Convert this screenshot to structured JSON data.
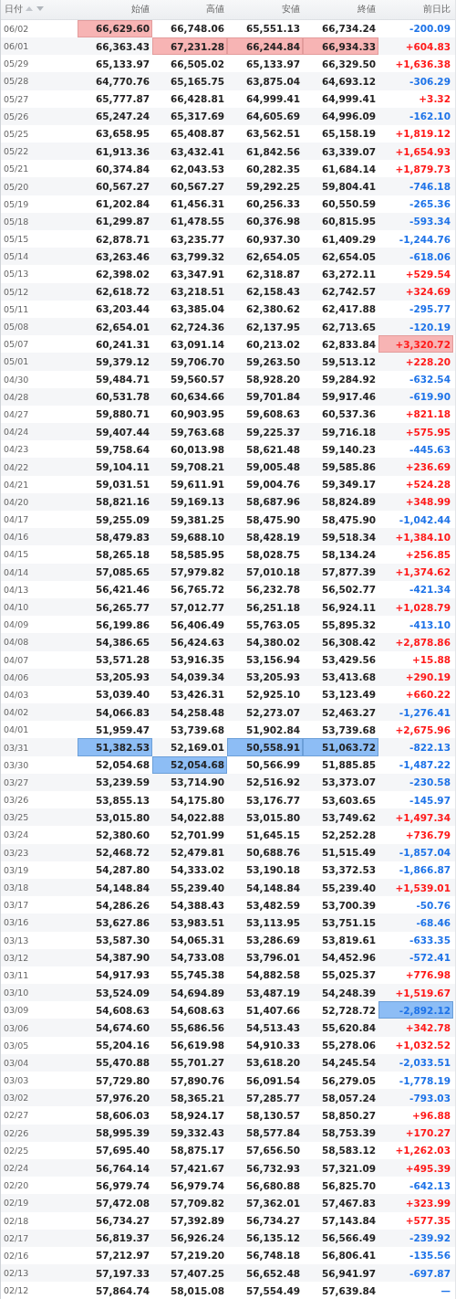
{
  "table": {
    "columns": [
      {
        "label": "日付",
        "sortable": true
      },
      {
        "label": "始値",
        "sortable": false
      },
      {
        "label": "高値",
        "sortable": false
      },
      {
        "label": "安値",
        "sortable": false
      },
      {
        "label": "終値",
        "sortable": false
      },
      {
        "label": "前日比",
        "sortable": false
      }
    ],
    "rows": [
      {
        "date": "06/02",
        "open": "66,629.60",
        "high": "66,748.06",
        "low": "65,551.13",
        "close": "66,734.24",
        "change": "-200.09",
        "up": false,
        "highest": {
          "open": true
        }
      },
      {
        "date": "06/01",
        "open": "66,363.43",
        "high": "67,231.28",
        "low": "66,244.84",
        "close": "66,934.33",
        "change": "+604.83",
        "up": true,
        "highest": {
          "high": true,
          "low": true,
          "close": true
        }
      },
      {
        "date": "05/29",
        "open": "65,133.97",
        "high": "66,505.02",
        "low": "65,133.97",
        "close": "66,329.50",
        "change": "+1,636.38",
        "up": true
      },
      {
        "date": "05/28",
        "open": "64,770.76",
        "high": "65,165.75",
        "low": "63,875.04",
        "close": "64,693.12",
        "change": "-306.29",
        "up": false
      },
      {
        "date": "05/27",
        "open": "65,777.87",
        "high": "66,428.81",
        "low": "64,999.41",
        "close": "64,999.41",
        "change": "+3.32",
        "up": true
      },
      {
        "date": "05/26",
        "open": "65,247.24",
        "high": "65,317.69",
        "low": "64,605.69",
        "close": "64,996.09",
        "change": "-162.10",
        "up": false
      },
      {
        "date": "05/25",
        "open": "63,658.95",
        "high": "65,408.87",
        "low": "63,562.51",
        "close": "65,158.19",
        "change": "+1,819.12",
        "up": true
      },
      {
        "date": "05/22",
        "open": "61,913.36",
        "high": "63,432.41",
        "low": "61,842.56",
        "close": "63,339.07",
        "change": "+1,654.93",
        "up": true
      },
      {
        "date": "05/21",
        "open": "60,374.84",
        "high": "62,043.53",
        "low": "60,282.35",
        "close": "61,684.14",
        "change": "+1,879.73",
        "up": true
      },
      {
        "date": "05/20",
        "open": "60,567.27",
        "high": "60,567.27",
        "low": "59,292.25",
        "close": "59,804.41",
        "change": "-746.18",
        "up": false
      },
      {
        "date": "05/19",
        "open": "61,202.84",
        "high": "61,456.31",
        "low": "60,256.33",
        "close": "60,550.59",
        "change": "-265.36",
        "up": false
      },
      {
        "date": "05/18",
        "open": "61,299.87",
        "high": "61,478.55",
        "low": "60,376.98",
        "close": "60,815.95",
        "change": "-593.34",
        "up": false
      },
      {
        "date": "05/15",
        "open": "62,878.71",
        "high": "63,235.77",
        "low": "60,937.30",
        "close": "61,409.29",
        "change": "-1,244.76",
        "up": false
      },
      {
        "date": "05/14",
        "open": "63,263.46",
        "high": "63,799.32",
        "low": "62,654.05",
        "close": "62,654.05",
        "change": "-618.06",
        "up": false
      },
      {
        "date": "05/13",
        "open": "62,398.02",
        "high": "63,347.91",
        "low": "62,318.87",
        "close": "63,272.11",
        "change": "+529.54",
        "up": true
      },
      {
        "date": "05/12",
        "open": "62,618.72",
        "high": "63,218.51",
        "low": "62,158.43",
        "close": "62,742.57",
        "change": "+324.69",
        "up": true
      },
      {
        "date": "05/11",
        "open": "63,203.44",
        "high": "63,385.04",
        "low": "62,380.62",
        "close": "62,417.88",
        "change": "-295.77",
        "up": false
      },
      {
        "date": "05/08",
        "open": "62,654.01",
        "high": "62,724.36",
        "low": "62,137.95",
        "close": "62,713.65",
        "change": "-120.19",
        "up": false
      },
      {
        "date": "05/07",
        "open": "60,241.31",
        "high": "63,091.14",
        "low": "60,213.02",
        "close": "62,833.84",
        "change": "+3,320.72",
        "up": true,
        "highest": {
          "change": true
        }
      },
      {
        "date": "05/01",
        "open": "59,379.12",
        "high": "59,706.70",
        "low": "59,263.50",
        "close": "59,513.12",
        "change": "+228.20",
        "up": true
      },
      {
        "date": "04/30",
        "open": "59,484.71",
        "high": "59,560.57",
        "low": "58,928.20",
        "close": "59,284.92",
        "change": "-632.54",
        "up": false
      },
      {
        "date": "04/28",
        "open": "60,531.78",
        "high": "60,634.66",
        "low": "59,701.84",
        "close": "59,917.46",
        "change": "-619.90",
        "up": false
      },
      {
        "date": "04/27",
        "open": "59,880.71",
        "high": "60,903.95",
        "low": "59,608.63",
        "close": "60,537.36",
        "change": "+821.18",
        "up": true
      },
      {
        "date": "04/24",
        "open": "59,407.44",
        "high": "59,763.68",
        "low": "59,225.37",
        "close": "59,716.18",
        "change": "+575.95",
        "up": true
      },
      {
        "date": "04/23",
        "open": "59,758.64",
        "high": "60,013.98",
        "low": "58,621.48",
        "close": "59,140.23",
        "change": "-445.63",
        "up": false
      },
      {
        "date": "04/22",
        "open": "59,104.11",
        "high": "59,708.21",
        "low": "59,005.48",
        "close": "59,585.86",
        "change": "+236.69",
        "up": true
      },
      {
        "date": "04/21",
        "open": "59,031.51",
        "high": "59,611.91",
        "low": "59,004.76",
        "close": "59,349.17",
        "change": "+524.28",
        "up": true
      },
      {
        "date": "04/20",
        "open": "58,821.16",
        "high": "59,169.13",
        "low": "58,687.96",
        "close": "58,824.89",
        "change": "+348.99",
        "up": true
      },
      {
        "date": "04/17",
        "open": "59,255.09",
        "high": "59,381.25",
        "low": "58,475.90",
        "close": "58,475.90",
        "change": "-1,042.44",
        "up": false
      },
      {
        "date": "04/16",
        "open": "58,479.83",
        "high": "59,688.10",
        "low": "58,428.19",
        "close": "59,518.34",
        "change": "+1,384.10",
        "up": true
      },
      {
        "date": "04/15",
        "open": "58,265.18",
        "high": "58,585.95",
        "low": "58,028.75",
        "close": "58,134.24",
        "change": "+256.85",
        "up": true
      },
      {
        "date": "04/14",
        "open": "57,085.65",
        "high": "57,979.82",
        "low": "57,010.18",
        "close": "57,877.39",
        "change": "+1,374.62",
        "up": true
      },
      {
        "date": "04/13",
        "open": "56,421.46",
        "high": "56,765.72",
        "low": "56,232.78",
        "close": "56,502.77",
        "change": "-421.34",
        "up": false
      },
      {
        "date": "04/10",
        "open": "56,265.77",
        "high": "57,012.77",
        "low": "56,251.18",
        "close": "56,924.11",
        "change": "+1,028.79",
        "up": true
      },
      {
        "date": "04/09",
        "open": "56,199.86",
        "high": "56,406.49",
        "low": "55,763.05",
        "close": "55,895.32",
        "change": "-413.10",
        "up": false
      },
      {
        "date": "04/08",
        "open": "54,386.65",
        "high": "56,424.63",
        "low": "54,380.02",
        "close": "56,308.42",
        "change": "+2,878.86",
        "up": true
      },
      {
        "date": "04/07",
        "open": "53,571.28",
        "high": "53,916.35",
        "low": "53,156.94",
        "close": "53,429.56",
        "change": "+15.88",
        "up": true
      },
      {
        "date": "04/06",
        "open": "53,205.93",
        "high": "54,039.34",
        "low": "53,205.93",
        "close": "53,413.68",
        "change": "+290.19",
        "up": true
      },
      {
        "date": "04/03",
        "open": "53,039.40",
        "high": "53,426.31",
        "low": "52,925.10",
        "close": "53,123.49",
        "change": "+660.22",
        "up": true
      },
      {
        "date": "04/02",
        "open": "54,066.83",
        "high": "54,258.48",
        "low": "52,273.07",
        "close": "52,463.27",
        "change": "-1,276.41",
        "up": false
      },
      {
        "date": "04/01",
        "open": "51,959.47",
        "high": "53,739.68",
        "low": "51,902.84",
        "close": "53,739.68",
        "change": "+2,675.96",
        "up": true
      },
      {
        "date": "03/31",
        "open": "51,382.53",
        "high": "52,169.01",
        "low": "50,558.91",
        "close": "51,063.72",
        "change": "-822.13",
        "up": false,
        "lowest": {
          "open": true,
          "low": true,
          "close": true
        }
      },
      {
        "date": "03/30",
        "open": "52,054.68",
        "high": "52,054.68",
        "low": "50,566.99",
        "close": "51,885.85",
        "change": "-1,487.22",
        "up": false,
        "lowest": {
          "high": true
        }
      },
      {
        "date": "03/27",
        "open": "53,239.59",
        "high": "53,714.90",
        "low": "52,516.92",
        "close": "53,373.07",
        "change": "-230.58",
        "up": false
      },
      {
        "date": "03/26",
        "open": "53,855.13",
        "high": "54,175.80",
        "low": "53,176.77",
        "close": "53,603.65",
        "change": "-145.97",
        "up": false
      },
      {
        "date": "03/25",
        "open": "53,015.80",
        "high": "54,022.88",
        "low": "53,015.80",
        "close": "53,749.62",
        "change": "+1,497.34",
        "up": true
      },
      {
        "date": "03/24",
        "open": "52,380.60",
        "high": "52,701.99",
        "low": "51,645.15",
        "close": "52,252.28",
        "change": "+736.79",
        "up": true
      },
      {
        "date": "03/23",
        "open": "52,468.72",
        "high": "52,479.81",
        "low": "50,688.76",
        "close": "51,515.49",
        "change": "-1,857.04",
        "up": false
      },
      {
        "date": "03/19",
        "open": "54,287.80",
        "high": "54,333.02",
        "low": "53,190.18",
        "close": "53,372.53",
        "change": "-1,866.87",
        "up": false
      },
      {
        "date": "03/18",
        "open": "54,148.84",
        "high": "55,239.40",
        "low": "54,148.84",
        "close": "55,239.40",
        "change": "+1,539.01",
        "up": true
      },
      {
        "date": "03/17",
        "open": "54,286.26",
        "high": "54,388.43",
        "low": "53,482.59",
        "close": "53,700.39",
        "change": "-50.76",
        "up": false
      },
      {
        "date": "03/16",
        "open": "53,627.86",
        "high": "53,983.51",
        "low": "53,113.95",
        "close": "53,751.15",
        "change": "-68.46",
        "up": false
      },
      {
        "date": "03/13",
        "open": "53,587.30",
        "high": "54,065.31",
        "low": "53,286.69",
        "close": "53,819.61",
        "change": "-633.35",
        "up": false
      },
      {
        "date": "03/12",
        "open": "54,387.90",
        "high": "54,733.08",
        "low": "53,796.01",
        "close": "54,452.96",
        "change": "-572.41",
        "up": false
      },
      {
        "date": "03/11",
        "open": "54,917.93",
        "high": "55,745.38",
        "low": "54,882.58",
        "close": "55,025.37",
        "change": "+776.98",
        "up": true
      },
      {
        "date": "03/10",
        "open": "53,524.09",
        "high": "54,694.89",
        "low": "53,487.19",
        "close": "54,248.39",
        "change": "+1,519.67",
        "up": true
      },
      {
        "date": "03/09",
        "open": "54,608.63",
        "high": "54,608.63",
        "low": "51,407.66",
        "close": "52,728.72",
        "change": "-2,892.12",
        "up": false,
        "lowest": {
          "change": true
        }
      },
      {
        "date": "03/06",
        "open": "54,674.60",
        "high": "55,686.56",
        "low": "54,513.43",
        "close": "55,620.84",
        "change": "+342.78",
        "up": true
      },
      {
        "date": "03/05",
        "open": "55,204.16",
        "high": "56,619.98",
        "low": "54,910.33",
        "close": "55,278.06",
        "change": "+1,032.52",
        "up": true
      },
      {
        "date": "03/04",
        "open": "55,470.88",
        "high": "55,701.27",
        "low": "53,618.20",
        "close": "54,245.54",
        "change": "-2,033.51",
        "up": false
      },
      {
        "date": "03/03",
        "open": "57,729.80",
        "high": "57,890.76",
        "low": "56,091.54",
        "close": "56,279.05",
        "change": "-1,778.19",
        "up": false
      },
      {
        "date": "03/02",
        "open": "57,976.20",
        "high": "58,365.21",
        "low": "57,285.77",
        "close": "58,057.24",
        "change": "-793.03",
        "up": false
      },
      {
        "date": "02/27",
        "open": "58,606.03",
        "high": "58,924.17",
        "low": "58,130.57",
        "close": "58,850.27",
        "change": "+96.88",
        "up": true
      },
      {
        "date": "02/26",
        "open": "58,995.39",
        "high": "59,332.43",
        "low": "58,577.84",
        "close": "58,753.39",
        "change": "+170.27",
        "up": true
      },
      {
        "date": "02/25",
        "open": "57,695.40",
        "high": "58,875.17",
        "low": "57,656.50",
        "close": "58,583.12",
        "change": "+1,262.03",
        "up": true
      },
      {
        "date": "02/24",
        "open": "56,764.14",
        "high": "57,421.67",
        "low": "56,732.93",
        "close": "57,321.09",
        "change": "+495.39",
        "up": true
      },
      {
        "date": "02/20",
        "open": "56,979.74",
        "high": "56,979.74",
        "low": "56,680.88",
        "close": "56,825.70",
        "change": "-642.13",
        "up": false
      },
      {
        "date": "02/19",
        "open": "57,472.08",
        "high": "57,709.82",
        "low": "57,362.01",
        "close": "57,467.83",
        "change": "+323.99",
        "up": true
      },
      {
        "date": "02/18",
        "open": "56,734.27",
        "high": "57,392.89",
        "low": "56,734.27",
        "close": "57,143.84",
        "change": "+577.35",
        "up": true
      },
      {
        "date": "02/17",
        "open": "56,819.37",
        "high": "56,926.24",
        "low": "56,135.12",
        "close": "56,566.49",
        "change": "-239.92",
        "up": false
      },
      {
        "date": "02/16",
        "open": "57,212.97",
        "high": "57,219.20",
        "low": "56,748.18",
        "close": "56,806.41",
        "change": "-135.56",
        "up": false
      },
      {
        "date": "02/13",
        "open": "57,197.33",
        "high": "57,407.25",
        "low": "56,652.48",
        "close": "56,941.97",
        "change": "-697.87",
        "up": false
      },
      {
        "date": "02/12",
        "open": "57,864.74",
        "high": "58,015.08",
        "low": "57,554.49",
        "close": "57,639.84",
        "change": "—",
        "up": false
      }
    ]
  }
}
